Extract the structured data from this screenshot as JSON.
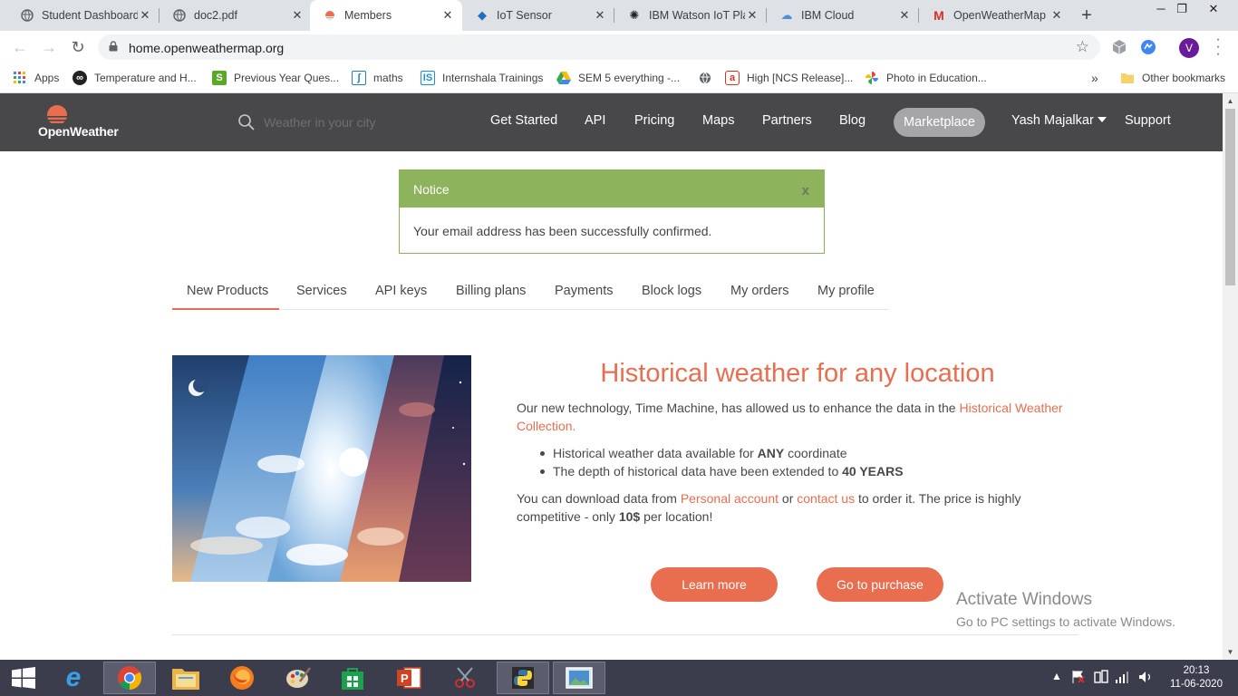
{
  "browser": {
    "tabs": [
      {
        "label": "Student Dashboard"
      },
      {
        "label": "doc2.pdf"
      },
      {
        "label": "Members"
      },
      {
        "label": "IoT Sensor"
      },
      {
        "label": "IBM Watson IoT Pla"
      },
      {
        "label": "IBM Cloud"
      },
      {
        "label": "OpenWeatherMap"
      }
    ],
    "url": "home.openweathermap.org",
    "profile_initial": "V",
    "bookmarks": [
      {
        "label": "Apps"
      },
      {
        "label": "Temperature and H..."
      },
      {
        "label": "Previous Year Ques..."
      },
      {
        "label": "maths"
      },
      {
        "label": "Internshala Trainings"
      },
      {
        "label": "SEM 5 everything -..."
      },
      {
        "label": ""
      },
      {
        "label": "High [NCS Release]..."
      },
      {
        "label": "Photo in Education..."
      }
    ],
    "more_bookmarks": "»",
    "other_bookmarks": "Other bookmarks"
  },
  "site": {
    "logo_text": "OpenWeather",
    "search_placeholder": "Weather in your city",
    "nav": [
      {
        "label": "Get Started"
      },
      {
        "label": "API"
      },
      {
        "label": "Pricing"
      },
      {
        "label": "Maps"
      },
      {
        "label": "Partners"
      },
      {
        "label": "Blog"
      },
      {
        "label": "Marketplace"
      },
      {
        "label": "Yash Majalkar"
      },
      {
        "label": "Support"
      }
    ]
  },
  "notice": {
    "title": "Notice",
    "close": "x",
    "message": "Your email address has been successfully confirmed."
  },
  "account_tabs": [
    {
      "label": "New Products"
    },
    {
      "label": "Services"
    },
    {
      "label": "API keys"
    },
    {
      "label": "Billing plans"
    },
    {
      "label": "Payments"
    },
    {
      "label": "Block logs"
    },
    {
      "label": "My orders"
    },
    {
      "label": "My profile"
    }
  ],
  "product": {
    "title": "Historical weather for any location",
    "p1_text": "Our new technology, Time Machine, has allowed us to enhance the data in the ",
    "p1_link": "Historical Weather Collection.",
    "bullet1_pre": "Historical weather data available for ",
    "bullet1_bold": "ANY",
    "bullet1_post": " coordinate",
    "bullet2_pre": "The depth of historical data have been extended to ",
    "bullet2_bold": "40 YEARS",
    "p2_pre": "You can download data from ",
    "p2_link1": "Personal account",
    "p2_mid": " or ",
    "p2_link2": "contact us",
    "p2_post": " to order it. The price is highly competitive - only ",
    "p2_bold": "10$",
    "p2_end": " per location!",
    "learn_more": "Learn more",
    "purchase": "Go to purchase"
  },
  "watermark": {
    "line1": "Activate Windows",
    "line2": "Go to PC settings to activate Windows."
  },
  "taskbar": {
    "time": "20:13",
    "date": "11-06-2020"
  }
}
